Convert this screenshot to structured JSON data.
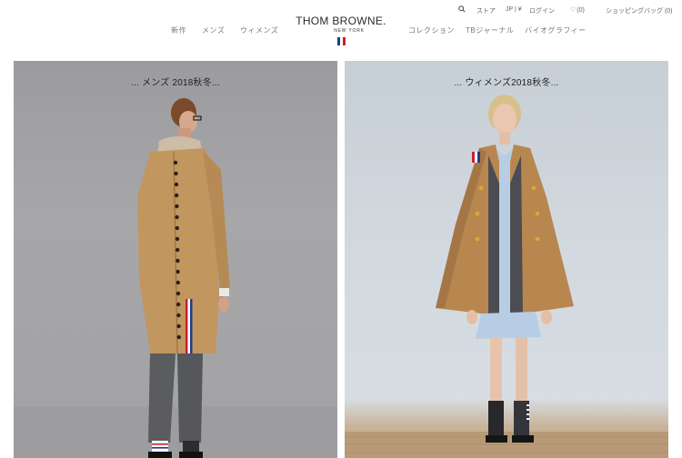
{
  "header": {
    "logo": {
      "main": "THOM BROWNE.",
      "sub": "NEW YORK"
    },
    "nav_left": [
      "新作",
      "メンズ",
      "ウィメンズ"
    ],
    "nav_right": [
      "コレクション",
      "TBジャーナル",
      "バイオグラフィー"
    ],
    "utility": {
      "store": "ストア",
      "locale": "JP | ¥",
      "login": "ログイン",
      "wishlist_count": "(0)",
      "bag": "ショッピングバッグ (0)"
    },
    "flag_colors": [
      "#1f3b8f",
      "#ffffff",
      "#c8202f"
    ]
  },
  "panels": [
    {
      "title": "... メンズ 2018秋冬..."
    },
    {
      "title": "... ウィメンズ2018秋冬..."
    }
  ],
  "colors": {
    "camel": "#b8874f",
    "grey_trouser": "#5a5c5f",
    "shirt_blue": "#b7cde4",
    "jacket_grey": "#4b4d52"
  }
}
